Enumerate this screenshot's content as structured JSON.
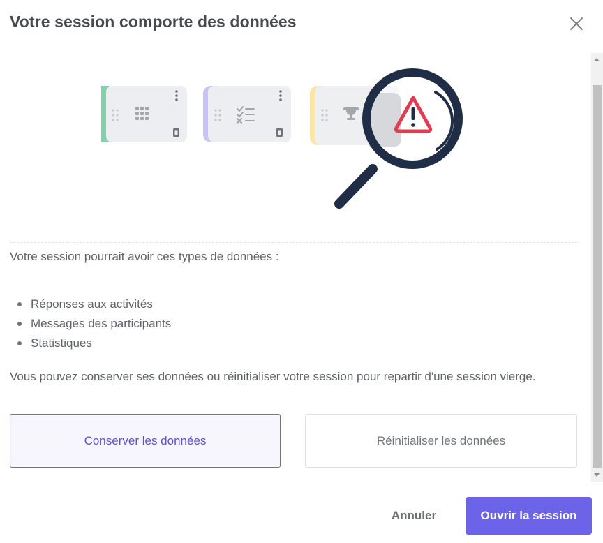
{
  "dialog": {
    "title": "Votre session comporte des données",
    "intro": "Votre session pourrait avoir ces types de données :",
    "data_types": [
      "Réponses aux activités",
      "Messages des participants",
      "Statistiques"
    ],
    "explanation": "Vous pouvez conserver ses données ou réinitialiser votre session pour repartir d'une session vierge.",
    "options": {
      "keep_label": "Conserver les données",
      "reset_label": "Réinitialiser les données",
      "selected": "keep"
    },
    "footer": {
      "cancel_label": "Annuler",
      "open_label": "Ouvrir la session"
    }
  },
  "illustration": {
    "cards": [
      {
        "accent": "#7fd4ac",
        "icon": "grid-icon"
      },
      {
        "accent": "#c9c3f3",
        "icon": "checklist-icon"
      },
      {
        "accent": "#fbe6a6",
        "icon": "trophy-icon"
      }
    ],
    "magnifier_color": "#1f2d46",
    "warning_color": "#e53a4f"
  },
  "colors": {
    "primary": "#6c63e8",
    "primary_text": "#5a51d6",
    "selected_bg": "#f7f6fd"
  }
}
